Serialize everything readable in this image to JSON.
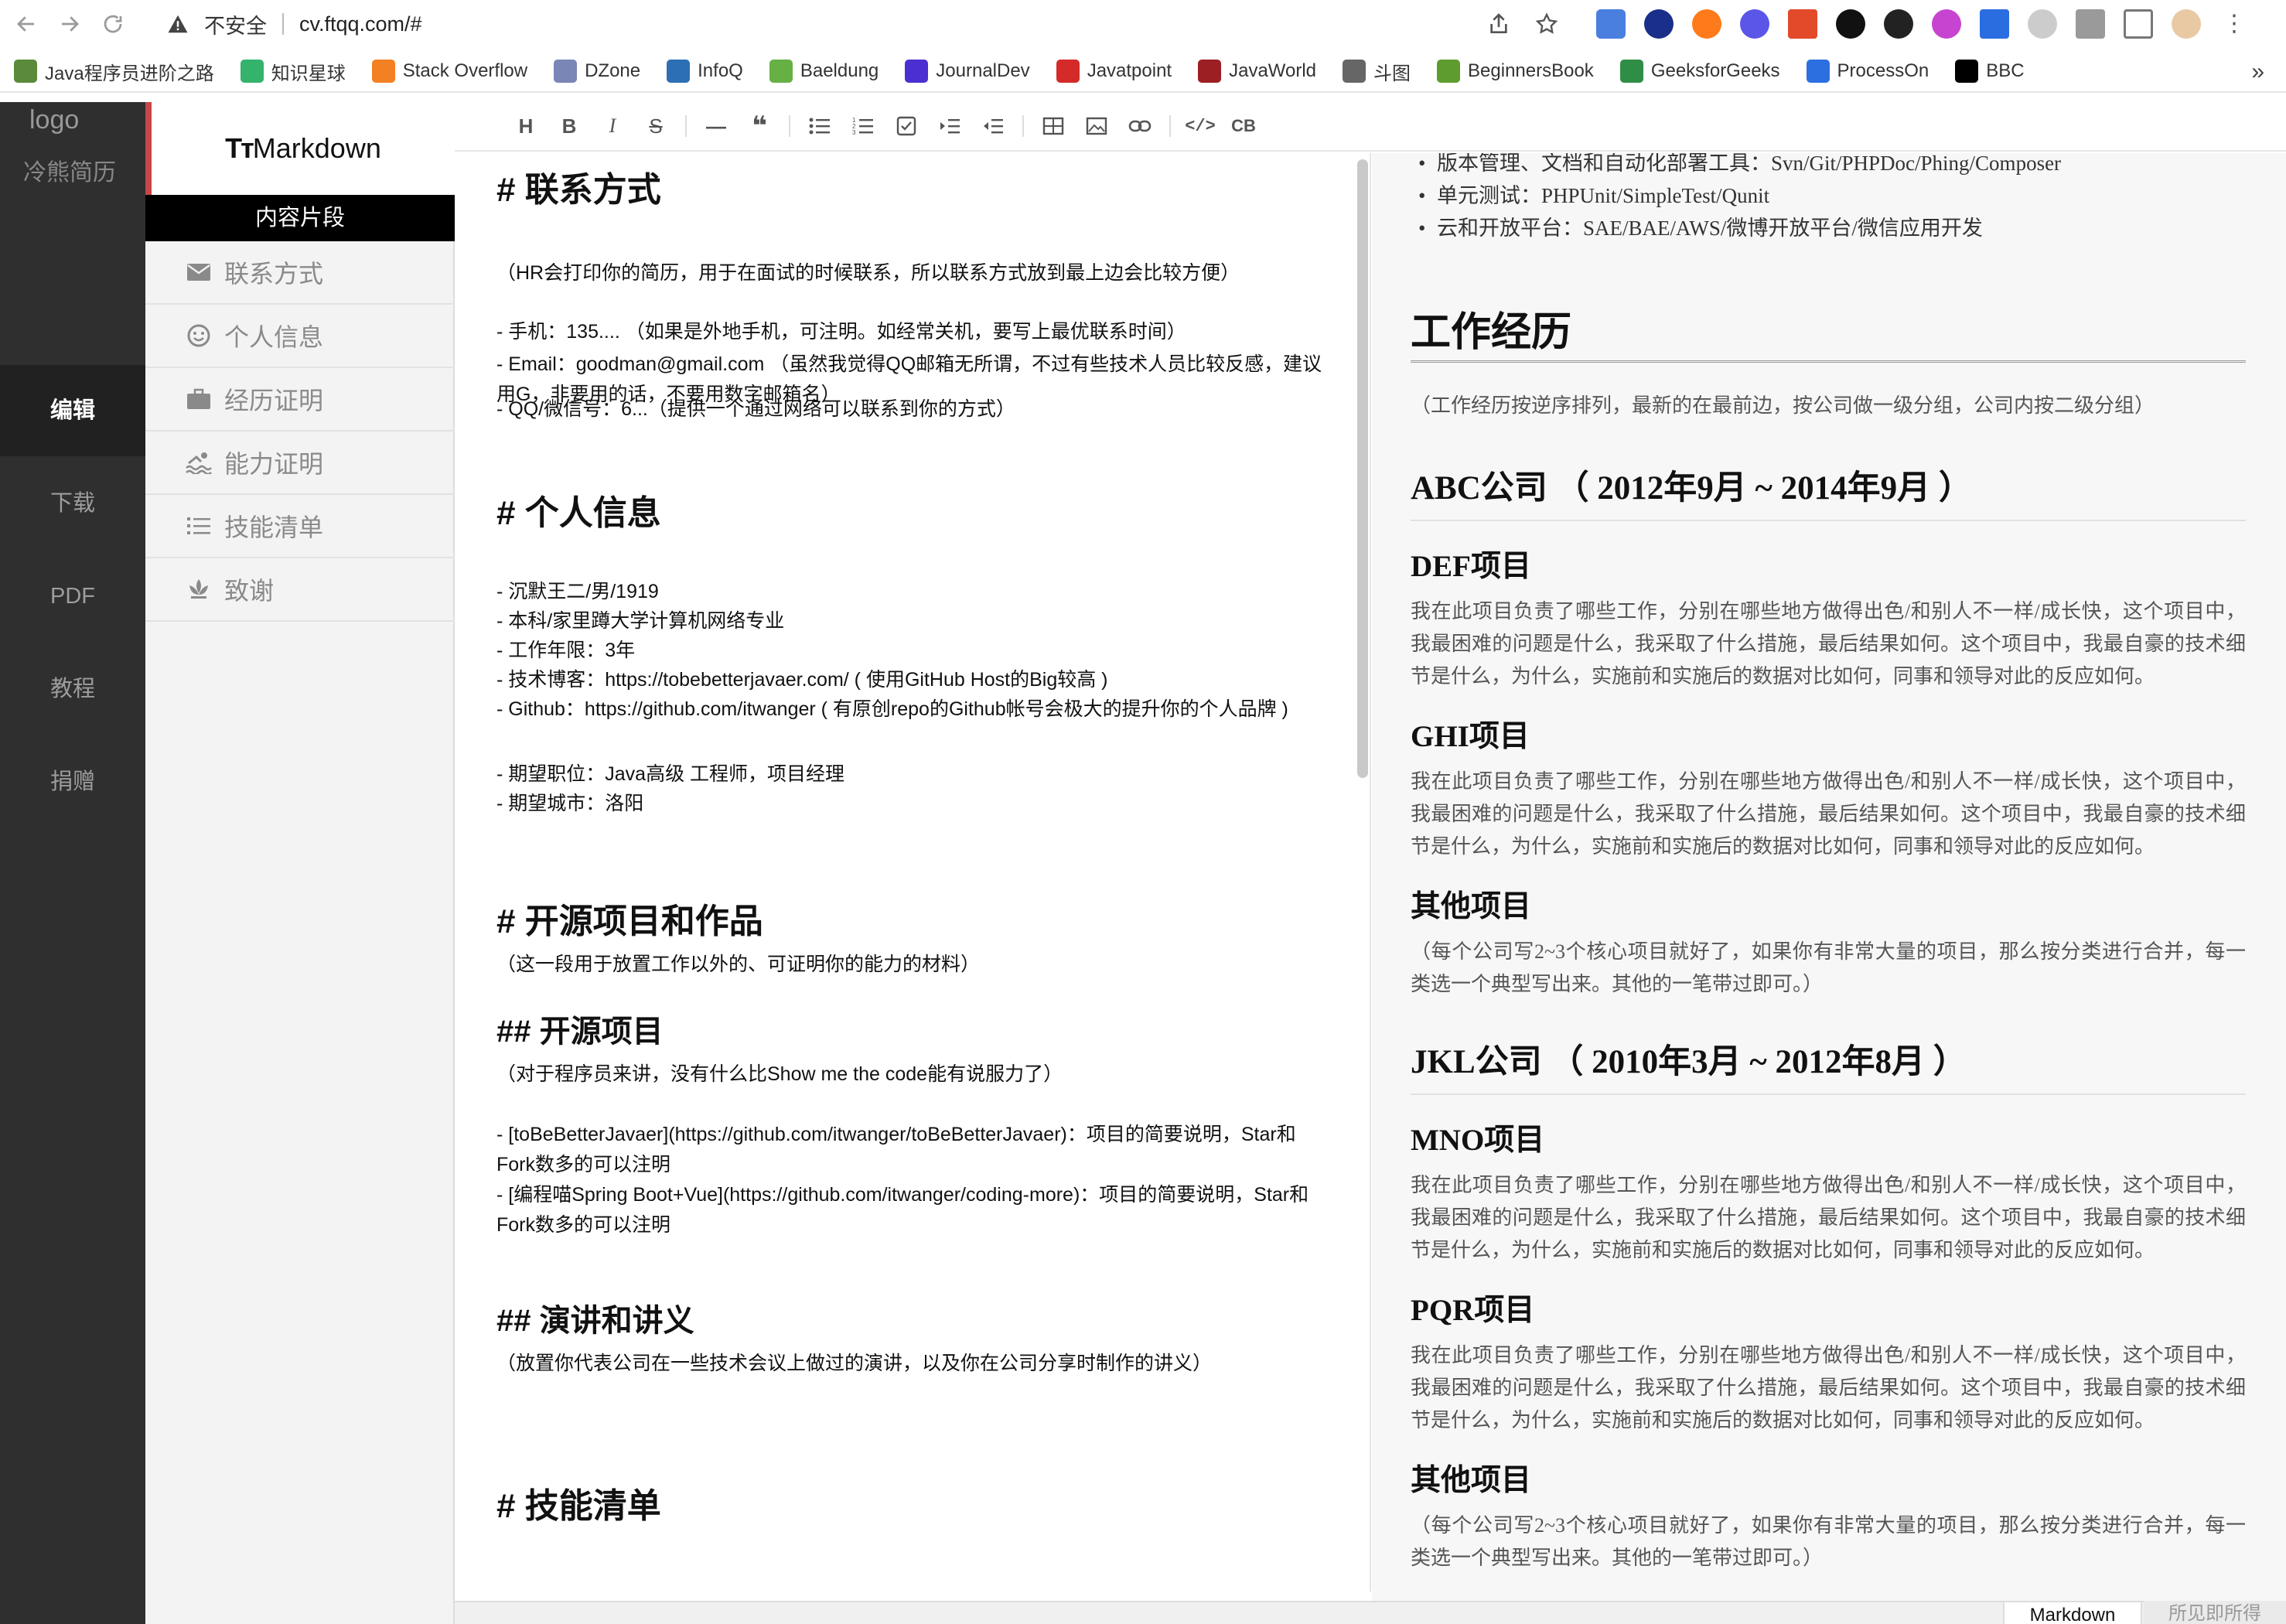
{
  "browser": {
    "insecure_label": "不安全",
    "url": "cv.ftqq.com/#"
  },
  "bookmarks": [
    {
      "label": "Java程序员进阶之路",
      "color": "#5a8a3a"
    },
    {
      "label": "知识星球",
      "color": "#34b36c"
    },
    {
      "label": "Stack Overflow",
      "color": "#f48024"
    },
    {
      "label": "DZone",
      "color": "#7a86b5"
    },
    {
      "label": "InfoQ",
      "color": "#2c6fb5"
    },
    {
      "label": "Baeldung",
      "color": "#66b044"
    },
    {
      "label": "JournalDev",
      "color": "#4c2fd1"
    },
    {
      "label": "Javatpoint",
      "color": "#d42a2a"
    },
    {
      "label": "JavaWorld",
      "color": "#9c1f24"
    },
    {
      "label": "斗图",
      "color": "#666666"
    },
    {
      "label": "BeginnersBook",
      "color": "#5f9c2f"
    },
    {
      "label": "GeeksforGeeks",
      "color": "#2f8d46"
    },
    {
      "label": "ProcessOn",
      "color": "#2c6fe0"
    },
    {
      "label": "BBC",
      "color": "#000000"
    }
  ],
  "nav": {
    "logo_alt": "logo",
    "brand": "冷熊简历",
    "items": [
      "编辑",
      "下载",
      "PDF",
      "教程",
      "捐赠"
    ],
    "active_index": 0
  },
  "snippets": {
    "brand_mark": "Tт",
    "brand_text": "Markdown",
    "section_title": "内容片段",
    "items": [
      {
        "label": "联系方式",
        "icon": "envelope-icon"
      },
      {
        "label": "个人信息",
        "icon": "smiley-icon"
      },
      {
        "label": "经历证明",
        "icon": "briefcase-icon"
      },
      {
        "label": "能力证明",
        "icon": "swimmer-icon"
      },
      {
        "label": "技能清单",
        "icon": "list-icon"
      },
      {
        "label": "致谢",
        "icon": "lotus-icon"
      }
    ]
  },
  "toolbar": {
    "buttons": [
      "H",
      "B",
      "I",
      "S",
      "—",
      "❝",
      "ul",
      "ol",
      "task",
      "indent",
      "outdent",
      "table",
      "image",
      "link",
      "code",
      "CB"
    ]
  },
  "editor": {
    "lines": [
      {
        "kind": "h1",
        "text": "# 联系方式"
      },
      {
        "kind": "p",
        "text": "（HR会打印你的简历，用于在面试的时候联系，所以联系方式放到最上边会比较方便）"
      },
      {
        "kind": "p",
        "text": "- 手机：135.... （如果是外地手机，可注明。如经常关机，要写上最优联系时间）"
      },
      {
        "kind": "p",
        "text": "- Email：goodman@gmail.com （虽然我觉得QQ邮箱无所谓，不过有些技术人员比较反感，建议用G，非要用的话，不要用数字邮箱名）"
      },
      {
        "kind": "p",
        "text": "- QQ/微信号：6...（提供一个通过网络可以联系到你的方式）"
      },
      {
        "kind": "h1",
        "text": "# 个人信息"
      },
      {
        "kind": "p",
        "text": " - 沉默王二/男/1919"
      },
      {
        "kind": "p",
        "text": " - 本科/家里蹲大学计算机网络专业"
      },
      {
        "kind": "p",
        "text": " - 工作年限：3年"
      },
      {
        "kind": "p",
        "text": " - 技术博客：https://tobebetterjavaer.com/ ( 使用GitHub Host的Big较高 )"
      },
      {
        "kind": "p",
        "text": " - Github：https://github.com/itwanger ( 有原创repo的Github帐号会极大的提升你的个人品牌 )"
      },
      {
        "kind": "p",
        "text": " - 期望职位：Java高级 工程师，项目经理"
      },
      {
        "kind": "p",
        "text": " - 期望城市：洛阳"
      },
      {
        "kind": "h1",
        "text": "# 开源项目和作品"
      },
      {
        "kind": "p",
        "text": "（这一段用于放置工作以外的、可证明你的能力的材料）"
      },
      {
        "kind": "h2",
        "text": "## 开源项目"
      },
      {
        "kind": "p",
        "text": "（对于程序员来讲，没有什么比Show me the code能有说服力了）"
      },
      {
        "kind": "p",
        "text": "  - [toBeBetterJavaer](https://github.com/itwanger/toBeBetterJavaer)：项目的简要说明，Star和Fork数多的可以注明"
      },
      {
        "kind": "p",
        "text": "  - [编程喵Spring Boot+Vue](https://github.com/itwanger/coding-more)：项目的简要说明，Star和Fork数多的可以注明"
      },
      {
        "kind": "h2",
        "text": "## 演讲和讲义"
      },
      {
        "kind": "p",
        "text": "（放置你代表公司在一些技术会议上做过的演讲，以及你在公司分享时制作的讲义）"
      },
      {
        "kind": "h1",
        "text": "# 技能清单"
      }
    ]
  },
  "preview": {
    "top_items": [
      "版本管理、文档和自动化部署工具：Svn/Git/PHPDoc/Phing/Composer",
      "单元测试：PHPUnit/SimpleTest/Qunit",
      "云和开放平台：SAE/BAE/AWS/微博开放平台/微信应用开发"
    ],
    "work_title": "工作经历",
    "work_note": "（工作经历按逆序排列，最新的在最前边，按公司做一级分组，公司内按二级分组）",
    "company1": "ABC公司 （ 2012年9月 ~ 2014年9月 ）",
    "company2": "JKL公司 （ 2010年3月 ~ 2012年8月 ）",
    "proj_def": "DEF项目",
    "proj_ghi": "GHI项目",
    "proj_other": "其他项目",
    "proj_mno": "MNO项目",
    "proj_pqr": "PQR项目",
    "proj_desc": "我在此项目负责了哪些工作，分别在哪些地方做得出色/和别人不一样/成长快，这个项目中，我最困难的问题是什么，我采取了什么措施，最后结果如何。这个项目中，我最自豪的技术细节是什么，为什么，实施前和实施后的数据对比如何，同事和领导对此的反应如何。",
    "other_desc": "（每个公司写2~3个核心项目就好了，如果你有非常大量的项目，那么按分类进行合并，每一类选一个典型写出来。其他的一笔带过即可。）"
  },
  "footer": {
    "tab_markdown": "Markdown",
    "tab_wysiwyg": "所见即所得"
  }
}
